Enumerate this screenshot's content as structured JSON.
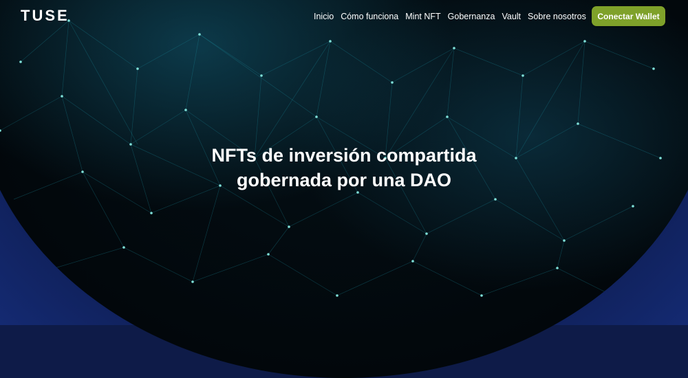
{
  "header": {
    "logo": "TUSE",
    "nav": [
      {
        "label": "Inicio"
      },
      {
        "label": "Cómo funciona"
      },
      {
        "label": "Mint NFT"
      },
      {
        "label": "Gobernanza"
      },
      {
        "label": "Vault"
      },
      {
        "label": "Sobre nosotros"
      }
    ],
    "wallet_button": "Conectar Wallet"
  },
  "hero": {
    "line1": "NFTs de inversión compartida",
    "line2": "gobernada por una DAO"
  },
  "colors": {
    "accent_button": "#7fa12a",
    "background_outer": "#142a72",
    "globe_dark": "#02070b",
    "mesh_teal": "#1aa0b0"
  }
}
